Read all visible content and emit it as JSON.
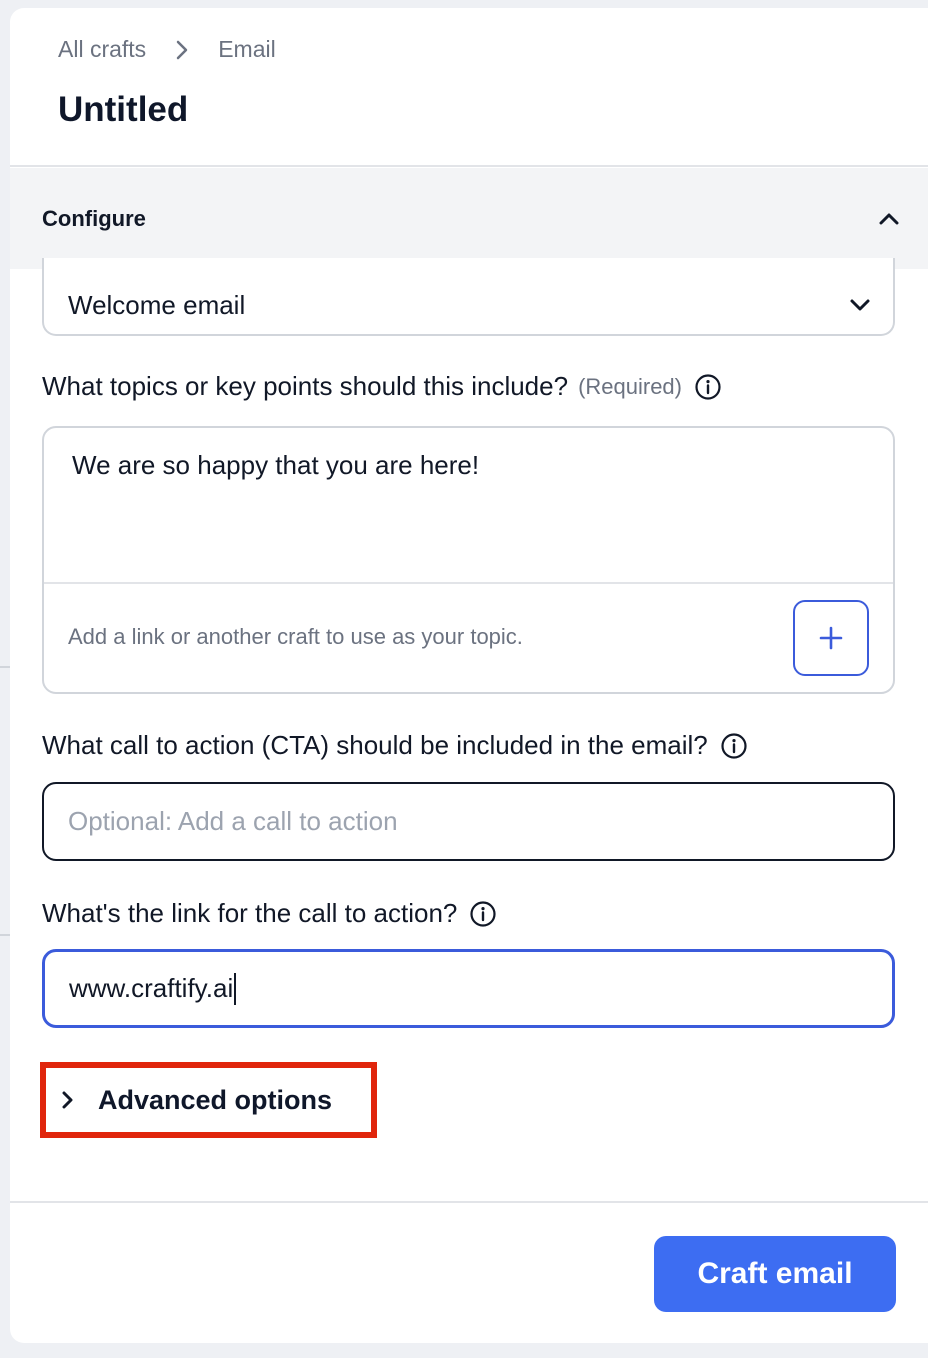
{
  "breadcrumb": {
    "root": "All crafts",
    "current": "Email"
  },
  "page_title": "Untitled",
  "configure": {
    "label": "Configure"
  },
  "email_type": {
    "value": "Welcome email"
  },
  "topics": {
    "label": "What topics or key points should this include?",
    "required_note": "(Required)",
    "value": "We are so happy that you are here!",
    "hint": "Add a link or another craft to use as your topic."
  },
  "cta": {
    "label": "What call to action (CTA) should be included in the email?",
    "placeholder": "Optional: Add a call to action",
    "value": ""
  },
  "cta_link": {
    "label": "What's the link for the call to action?",
    "value": "www.craftify.ai"
  },
  "advanced": {
    "label": "Advanced options"
  },
  "submit": {
    "label": "Craft email"
  },
  "colors": {
    "accent": "#3d6df2",
    "highlight": "#e0260c"
  }
}
